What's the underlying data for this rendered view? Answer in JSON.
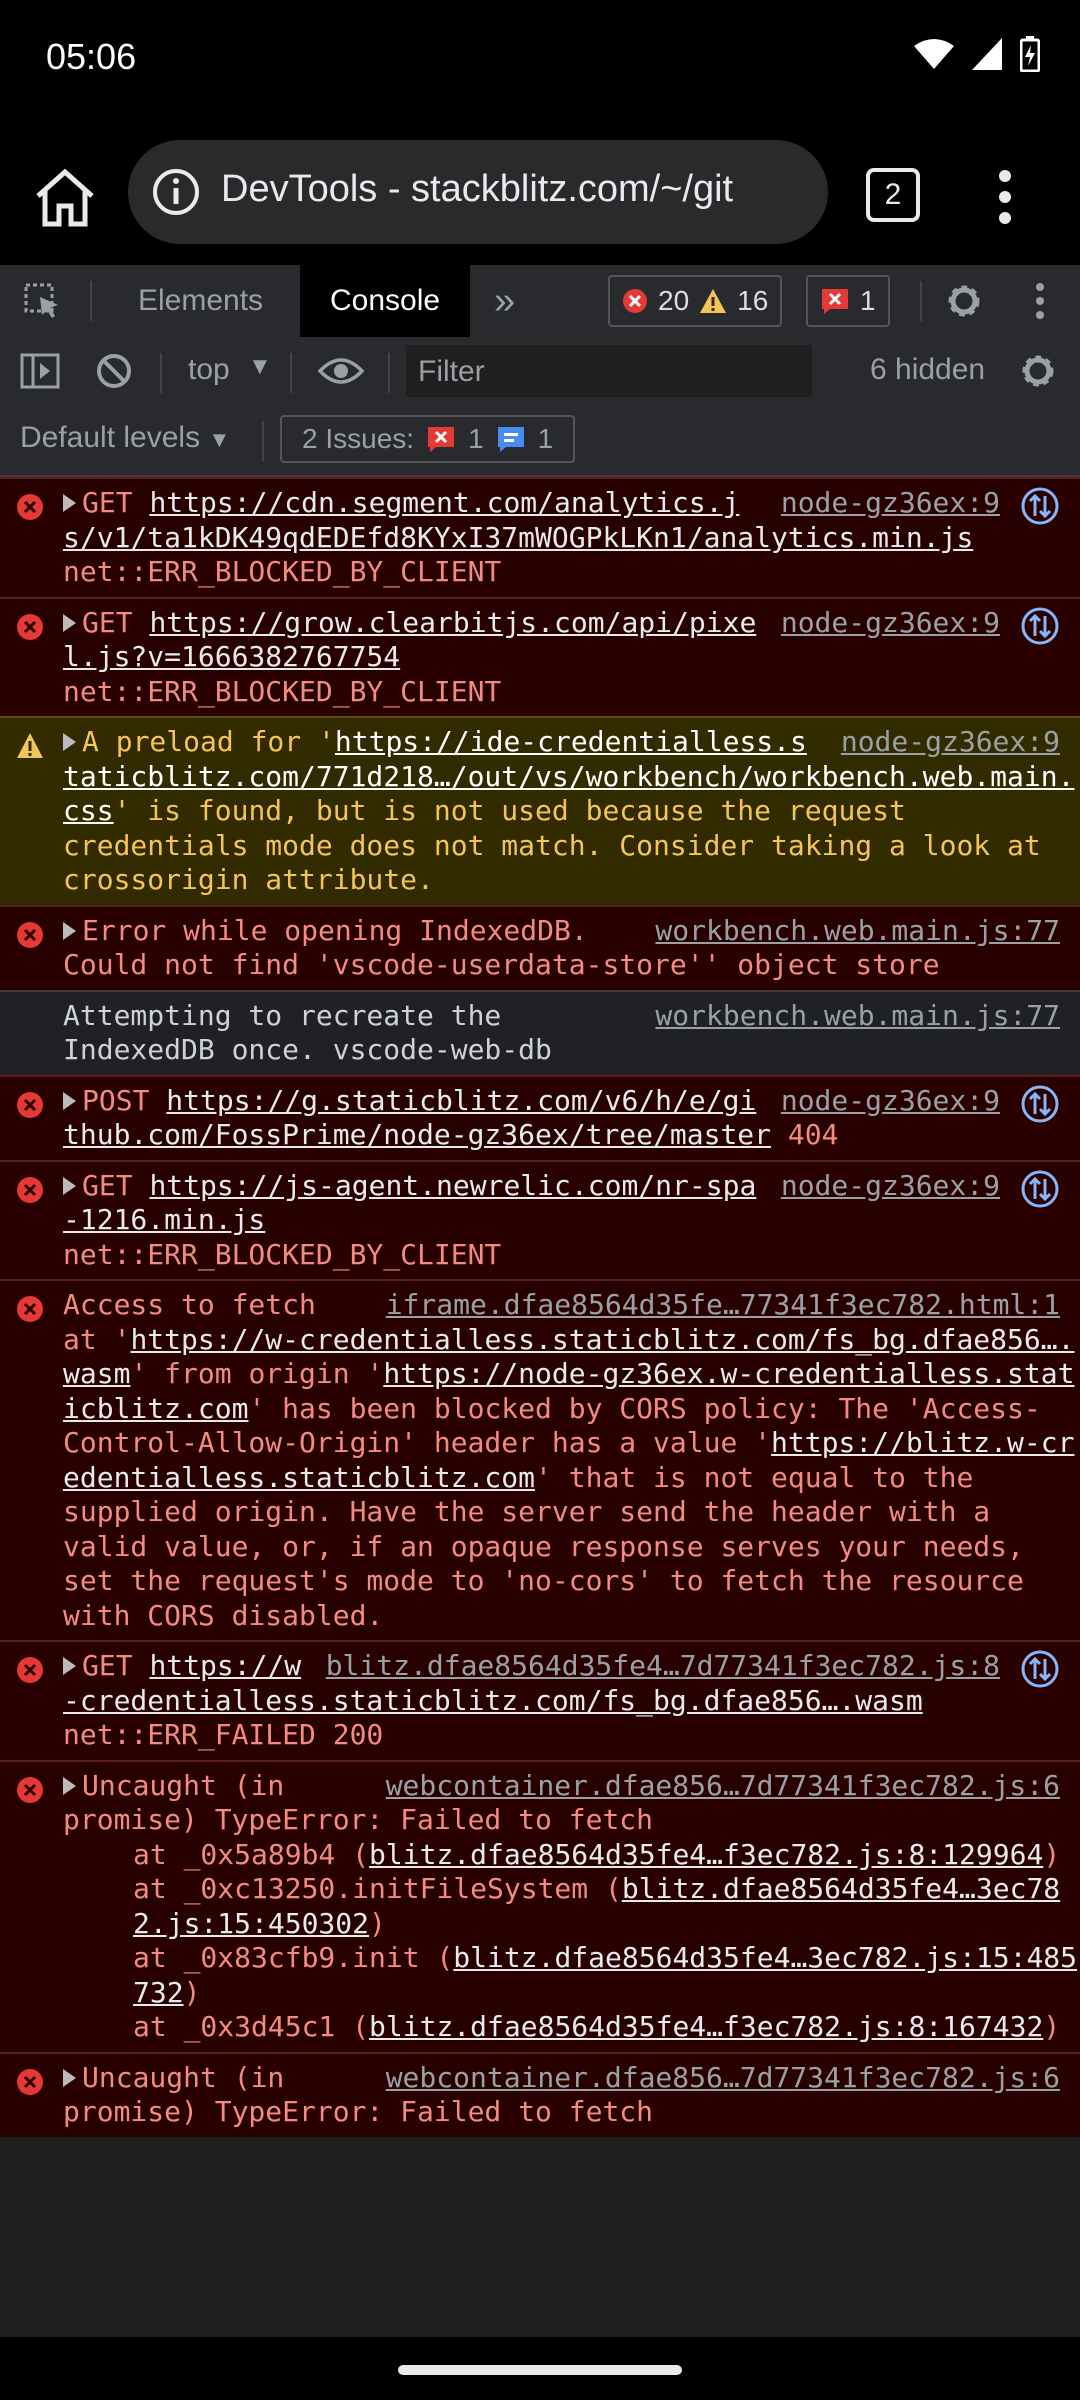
{
  "status_bar": {
    "time": "05:06"
  },
  "browser": {
    "url_text": "DevTools - stackblitz.com/~/git",
    "tab_count": "2"
  },
  "devtools": {
    "tabs": {
      "elements": "Elements",
      "console": "Console",
      "more": "»"
    },
    "counters": {
      "errors": "20",
      "warnings": "16",
      "issues_errors": "1"
    },
    "toolbar": {
      "context": "top",
      "filter_placeholder": "Filter",
      "hidden": "6 hidden"
    },
    "levels": {
      "default_levels": "Default levels",
      "issues_label": "2 Issues:",
      "issues_errors": "1",
      "issues_info": "1"
    }
  },
  "console": {
    "e1": {
      "method": "GET",
      "url": "https://cdn.segment.com/analytics.js/v1/ta1kDK49qdEDEfd8KYxI37mWOGPkLKn1/analytics.min.js",
      "err": "net::ERR_BLOCKED_BY_CLIENT",
      "src": "node-gz36ex:9"
    },
    "e2": {
      "method": "GET",
      "url": "https://grow.clearbitjs.com/api/pixel.js?v=1666382767754",
      "err": "net::ERR_BLOCKED_BY_CLIENT",
      "src": "node-gz36ex:9"
    },
    "w1": {
      "pre": "A preload for '",
      "url": "https://ide-credentialless.staticblitz.com/771d218…/out/vs/workbench/workbench.web.main.css",
      "post": "' is found, but is not used because the request credentials mode does not match. Consider taking a look at crossorigin attribute.",
      "src": "node-gz36ex:9"
    },
    "e3": {
      "text": "Error while opening IndexedDB. Could not find 'vscode-userdata-store'' object store",
      "src": "workbench.web.main.js:77"
    },
    "i1": {
      "text": "Attempting to recreate the IndexedDB once. vscode-web-db",
      "src": "workbench.web.main.js:77"
    },
    "e4": {
      "method": "POST",
      "url": "https://g.staticblitz.com/v6/h/e/github.com/FossPrime/node-gz36ex/tree/master",
      "status": "404",
      "src": "node-gz36ex:9"
    },
    "e5": {
      "method": "GET",
      "url": "https://js-agent.newrelic.com/nr-spa-1216.min.js",
      "err": "net::ERR_BLOCKED_BY_CLIENT",
      "src": "node-gz36ex:9"
    },
    "e6": {
      "src": "iframe.dfae8564d35fe…77341f3ec782.html:1",
      "t1": "Access to fetch at '",
      "u1": "https://w-credentialless.staticblitz.com/fs_bg.dfae856….wasm",
      "t2": "' from origin '",
      "u2": "https://node-gz36ex.w-credentialless.staticblitz.com",
      "t3": "' has been blocked by CORS policy: The 'Access-Control-Allow-Origin' header has a value '",
      "u3": "https://blitz.w-credentialless.staticblitz.com",
      "t4": "' that is not equal to the supplied origin. Have the server send the header with a valid value, or, if an opaque response serves your needs, set the request's mode to 'no-cors' to fetch the resource with CORS disabled."
    },
    "e7": {
      "method": "GET",
      "url": "https://w-credentialless.staticblitz.com/fs_bg.dfae856….wasm",
      "err": "net::ERR_FAILED 200",
      "src": "blitz.dfae8564d35fe4…7d77341f3ec782.js:8"
    },
    "e8": {
      "text": "Uncaught (in promise) TypeError: Failed to fetch",
      "src": "webcontainer.dfae856…7d77341f3ec782.js:6",
      "s1f": "at _0x5a89b4 (",
      "s1u": "blitz.dfae8564d35fe4…f3ec782.js:8:129964",
      "s2f": "at _0xc13250.initFileSystem (",
      "s2u": "blitz.dfae8564d35fe4…3ec782.js:15:450302",
      "s3f": "at _0x83cfb9.init (",
      "s3u": "blitz.dfae8564d35fe4…3ec782.js:15:485732",
      "s4f": "at _0x3d45c1 (",
      "s4u": "blitz.dfae8564d35fe4…f3ec782.js:8:167432",
      "close": ")"
    },
    "e9": {
      "text": "Uncaught (in promise) TypeError: Failed to fetch",
      "src": "webcontainer.dfae856…7d77341f3ec782.js:6"
    }
  }
}
